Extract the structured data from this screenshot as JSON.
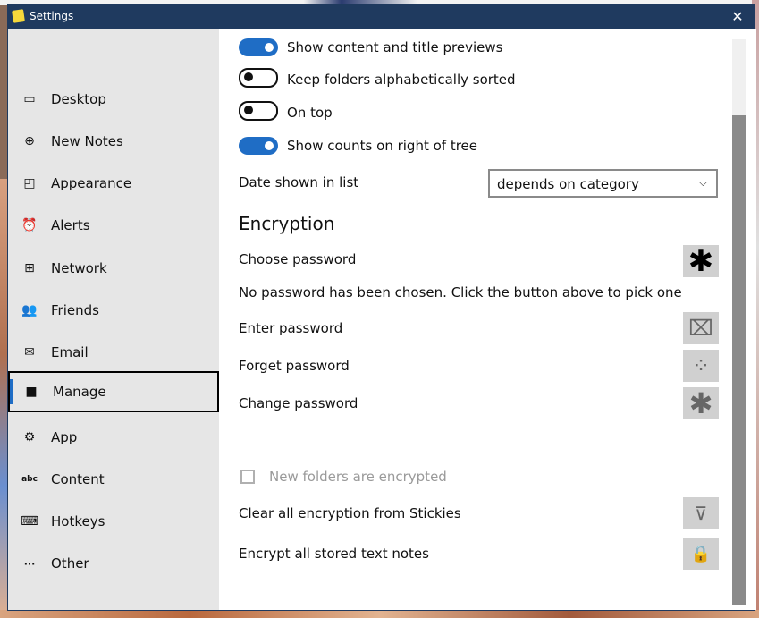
{
  "window": {
    "title": "Settings",
    "close_glyph": "✕"
  },
  "sidebar": {
    "items": [
      {
        "label": "Desktop",
        "icon": "monitor-icon",
        "glyph": "▭"
      },
      {
        "label": "New Notes",
        "icon": "plus-circle-icon",
        "glyph": "⊕"
      },
      {
        "label": "Appearance",
        "icon": "note-icon",
        "glyph": "◰"
      },
      {
        "label": "Alerts",
        "icon": "alarm-clock-icon",
        "glyph": "⏰"
      },
      {
        "label": "Network",
        "icon": "network-icon",
        "glyph": "⊞"
      },
      {
        "label": "Friends",
        "icon": "people-icon",
        "glyph": "👥"
      },
      {
        "label": "Email",
        "icon": "mail-icon",
        "glyph": "✉"
      },
      {
        "label": "Manage",
        "icon": "folder-icon",
        "glyph": "■",
        "selected": true
      },
      {
        "label": "App",
        "icon": "gear-icon",
        "glyph": "⚙"
      },
      {
        "label": "Content",
        "icon": "abc-icon",
        "glyph": "abc"
      },
      {
        "label": "Hotkeys",
        "icon": "keyboard-icon",
        "glyph": "⌨"
      },
      {
        "label": "Other",
        "icon": "ellipsis-icon",
        "glyph": "···"
      }
    ]
  },
  "toggles": [
    {
      "label": "Show content and title previews",
      "on": true
    },
    {
      "label": "Keep folders alphabetically sorted",
      "on": false
    },
    {
      "label": "On top",
      "on": false
    },
    {
      "label": "Show counts on right of tree",
      "on": true
    }
  ],
  "date_shown": {
    "label": "Date shown in list",
    "value": "depends on category",
    "chevron": "⌵"
  },
  "encryption": {
    "title": "Encryption",
    "choose_password": "Choose password",
    "no_password_text": "No password has been chosen.  Click the button above to pick one",
    "enter_password": "Enter password",
    "forget_password": "Forget password",
    "change_password": "Change password",
    "new_folders_encrypted": "New folders are encrypted",
    "clear_all": "Clear all encryption from Stickies",
    "encrypt_all": "Encrypt all stored text notes",
    "icons": {
      "choose": "✱",
      "enter": "⌧",
      "forget": "⁘",
      "change": "✱",
      "clear": "⊽",
      "encrypt": "🔒"
    }
  },
  "colors": {
    "accent": "#1f6dc5",
    "titlebar": "#1f3a5f",
    "sidebar_bg": "#e6e6e6",
    "button_bg": "#d0d0d0"
  }
}
